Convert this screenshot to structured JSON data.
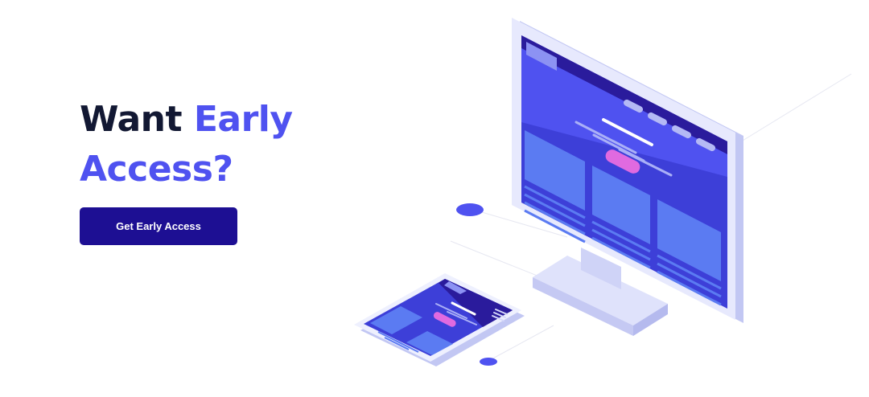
{
  "hero": {
    "heading_plain": "Want ",
    "heading_accent": "Early Access?",
    "cta_label": "Get Early Access"
  },
  "colors": {
    "heading_text": "#121833",
    "accent": "#4f52f0",
    "cta_background": "#1d0f93",
    "cta_text": "#ffffff",
    "screen_primary": "#4f52f0",
    "screen_dark": "#2a1b9c",
    "screen_highlight": "#e06ae0",
    "device_frame": "#dfe2fb",
    "background": "#ffffff"
  },
  "illustration": {
    "icons": [
      "desktop-monitor-icon",
      "smartphone-icon",
      "connector-dot-icon"
    ]
  }
}
